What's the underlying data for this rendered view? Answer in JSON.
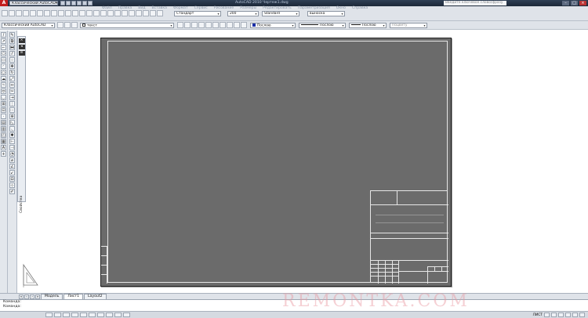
{
  "titlebar": {
    "workspace": "Классический AutoCAD",
    "doc_title": "AutoCAD 2010  Чертеж1.dwg",
    "search_placeholder": "Введите ключевое слово/фразу",
    "logo_letter": "A"
  },
  "menu": [
    "Файл",
    "Правка",
    "Вид",
    "Вставка",
    "Формат",
    "Сервис",
    "Рисование",
    "Размеры",
    "Редактировать",
    "Параметризация",
    "Окно",
    "Справка"
  ],
  "toolbar": {
    "text_style": "Стандарт",
    "dim_scale": "200",
    "table_style": "Standard",
    "multileader_style": "выноска",
    "text_layer": "текст",
    "color": "Послою",
    "linetype": "Послою",
    "lineweight": "Послою",
    "plotstyle": "Поцвету"
  },
  "properties_panel": {
    "label": "Свойства"
  },
  "layout_tabs": [
    {
      "label": "Модель",
      "active": false
    },
    {
      "label": "Лист1",
      "active": true
    },
    {
      "label": "Layout2",
      "active": false
    }
  ],
  "command_lines": [
    "Команда:",
    "Команда:"
  ],
  "status": {
    "space": "ЛИСТ",
    "icon_names": [
      "snap-icon",
      "grid-icon",
      "ortho-icon",
      "polar-icon",
      "osnap-icon",
      "otrack-icon",
      "ducs-icon",
      "dyn-icon",
      "lwt-icon",
      "qp-icon"
    ]
  },
  "watermark": "REMONTKA.COM",
  "colors": {
    "sheet": "#6b6b6b",
    "title_bar": "#1c2838",
    "frame_lines": "#e6e6e6"
  }
}
